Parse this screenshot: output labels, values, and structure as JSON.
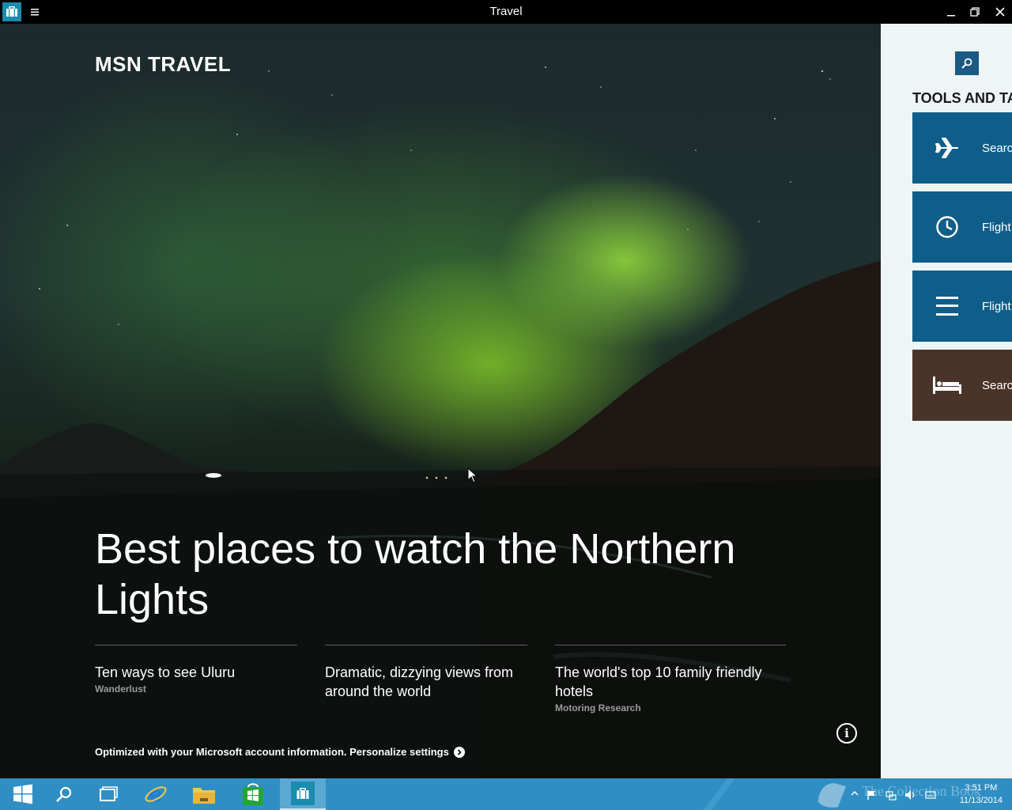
{
  "window": {
    "title": "Travel",
    "icons": {
      "app": "briefcase-icon",
      "menu": "hamburger-icon",
      "minimize": "minimize-icon",
      "restore": "restore-icon",
      "close": "close-icon"
    }
  },
  "hero": {
    "brand": "MSN TRAVEL",
    "headline": "Best places to watch the Northern Lights",
    "stories": [
      {
        "title": "Ten ways to see Uluru",
        "source": "Wanderlust"
      },
      {
        "title": "Dramatic, dizzying views from around the world",
        "source": ""
      },
      {
        "title": "The world's top 10 family friendly hotels",
        "source": "Motoring Research"
      }
    ],
    "personalize_text": "Optimized with your Microsoft account information. Personalize settings"
  },
  "side": {
    "section_title": "TOOLS AND TA",
    "tiles": [
      {
        "label": "Searc",
        "icon": "airplane-icon",
        "color": "#0f5e8a"
      },
      {
        "label": "Flight",
        "icon": "clock-icon",
        "color": "#0f5e8a"
      },
      {
        "label": "Flight",
        "icon": "list-icon",
        "color": "#0f5e8a"
      },
      {
        "label": "Searc",
        "icon": "bed-icon",
        "color": "#4a3328"
      }
    ]
  },
  "taskbar": {
    "time": "3:51 PM",
    "date": "11/13/2014",
    "watermark": "The Collection Book",
    "accent": "#2f8fc4",
    "items": [
      "start-icon",
      "search-icon",
      "task-view-icon",
      "internet-explorer-icon",
      "file-explorer-icon",
      "store-icon",
      "travel-icon"
    ]
  }
}
